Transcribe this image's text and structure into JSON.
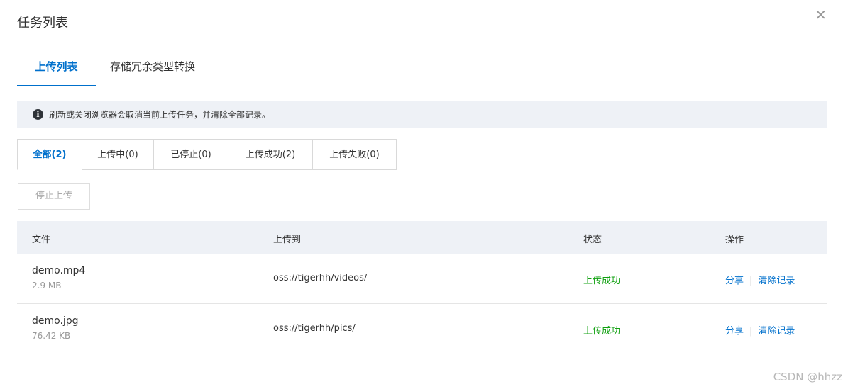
{
  "dialog": {
    "title": "任务列表",
    "close_glyph": "✕"
  },
  "tabs": [
    {
      "label": "上传列表",
      "active": true
    },
    {
      "label": "存储冗余类型转换",
      "active": false
    }
  ],
  "notice": {
    "icon": "info-icon",
    "text": "刷新或关闭浏览器会取消当前上传任务，并清除全部记录。"
  },
  "filters": [
    {
      "label": "全部(2)",
      "active": true
    },
    {
      "label": "上传中(0)",
      "active": false
    },
    {
      "label": "已停止(0)",
      "active": false
    },
    {
      "label": "上传成功(2)",
      "active": false
    },
    {
      "label": "上传失败(0)",
      "active": false
    }
  ],
  "stop_button": {
    "label": "停止上传",
    "disabled": true
  },
  "table": {
    "headers": {
      "file": "文件",
      "dest": "上传到",
      "status": "状态",
      "action": "操作"
    },
    "rows": [
      {
        "name": "demo.mp4",
        "size": "2.9 MB",
        "dest": "oss://tigerhh/videos/",
        "status": "上传成功",
        "share": "分享",
        "clear": "清除记录"
      },
      {
        "name": "demo.jpg",
        "size": "76.42 KB",
        "dest": "oss://tigerhh/pics/",
        "status": "上传成功",
        "share": "分享",
        "clear": "清除记录"
      }
    ]
  },
  "watermark": "CSDN @hhzz",
  "colors": {
    "accent": "#0070cc",
    "success": "#12a112",
    "notice_bg": "#eef1f6"
  }
}
